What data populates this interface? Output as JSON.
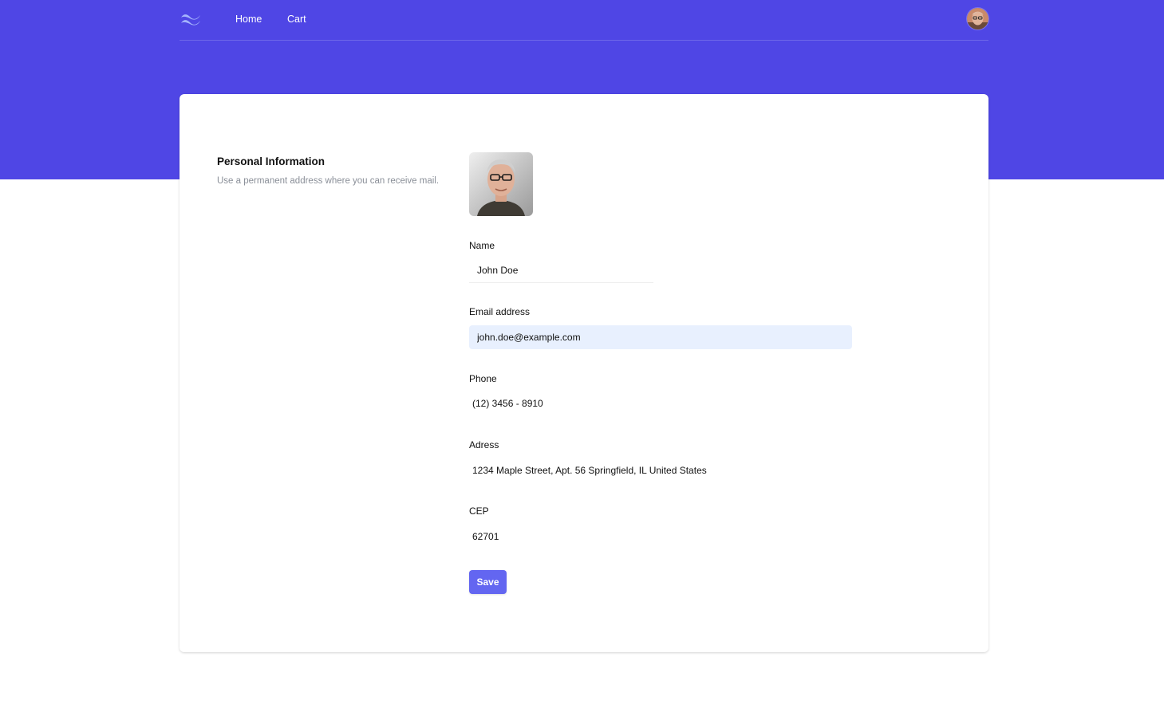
{
  "nav": {
    "logo_icon": "wave-logo-icon",
    "links": [
      {
        "label": "Home"
      },
      {
        "label": "Cart"
      }
    ],
    "avatar_icon": "user-avatar"
  },
  "profile": {
    "title": "Personal Information",
    "description": "Use a permanent address where you can receive mail.",
    "photo_icon": "profile-photo"
  },
  "form": {
    "name": {
      "label": "Name",
      "value": "John Doe"
    },
    "email": {
      "label": "Email address",
      "value": "john.doe@example.com"
    },
    "phone": {
      "label": "Phone",
      "value": "(12) 3456 - 8910"
    },
    "address": {
      "label": "Adress",
      "value": "1234 Maple Street, Apt. 56 Springfield, IL United States"
    },
    "cep": {
      "label": "CEP",
      "value": "62701"
    },
    "save_label": "Save"
  },
  "colors": {
    "header_bg": "#4f46e5",
    "button_bg": "#6366f1",
    "autofill_bg": "#e8f0fe"
  }
}
